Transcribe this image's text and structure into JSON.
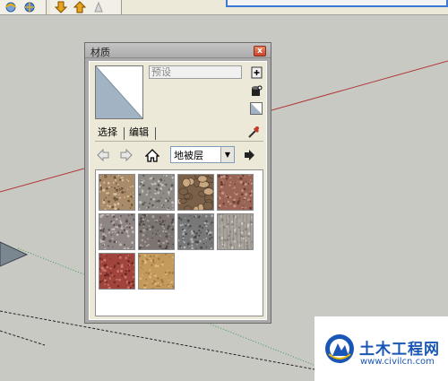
{
  "window": {
    "title": "材质",
    "close_label": "x"
  },
  "material": {
    "name_value": "预设"
  },
  "tabs": [
    {
      "label": "选择",
      "active": true
    },
    {
      "label": "编辑",
      "active": false
    }
  ],
  "library": {
    "selected": "地被层"
  },
  "swatches": [
    {
      "name": "gravel-1",
      "base": "#a98b6a",
      "dots": "#6b553c",
      "light": "#d9c3a2"
    },
    {
      "name": "gravel-2",
      "base": "#8e8b87",
      "dots": "#5b5855",
      "light": "#c3c0bb"
    },
    {
      "name": "pebbles",
      "base": "#7a6048",
      "dots": "#4a3828",
      "light": "#c9a780"
    },
    {
      "name": "red-earth",
      "base": "#9b6556",
      "dots": "#6a3d32",
      "light": "#c69384"
    },
    {
      "name": "gravel-3",
      "base": "#8d8685",
      "dots": "#5d5252",
      "light": "#c7b6b3"
    },
    {
      "name": "gravel-4",
      "base": "#7b7470",
      "dots": "#4f4946",
      "light": "#a9a19b"
    },
    {
      "name": "gravel-5",
      "base": "#797879",
      "dots": "#4a494a",
      "light": "#b2b1b2"
    },
    {
      "name": "concrete",
      "base": "#a8a49d",
      "dots": "#85817a",
      "light": "#cfcbc3"
    },
    {
      "name": "red-brick",
      "base": "#a0443c",
      "dots": "#6e2824",
      "light": "#c9766b"
    },
    {
      "name": "sand",
      "base": "#c49a5c",
      "dots": "#a27a40",
      "light": "#deb87c"
    }
  ],
  "watermark": {
    "title": "土木工程网",
    "url": "www.civilcn.com"
  },
  "colors": {
    "axis_red": "#b03a3a",
    "axis_green": "#3f9a4a"
  }
}
